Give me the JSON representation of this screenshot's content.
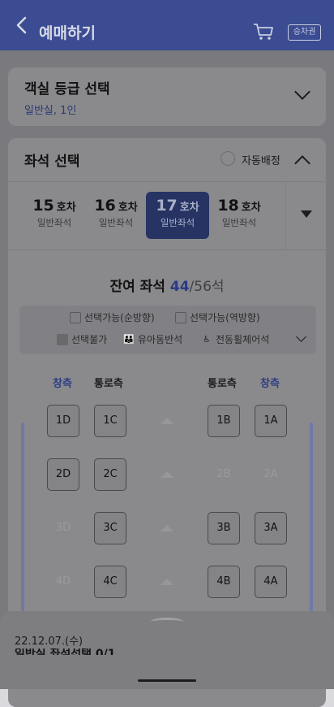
{
  "header": {
    "title": "예매하기",
    "ticket_label": "승차권"
  },
  "class_card": {
    "title": "객실 등급 선택",
    "subtitle": "일반실, 1인"
  },
  "seat_card": {
    "title": "좌석 선택",
    "auto_assign": "자동배정",
    "cars": [
      {
        "num": "15",
        "unit": "호차",
        "type": "일반좌석"
      },
      {
        "num": "16",
        "unit": "호차",
        "type": "일반좌석"
      },
      {
        "num": "17",
        "unit": "호차",
        "type": "일반좌석"
      },
      {
        "num": "18",
        "unit": "호차",
        "type": "일반좌석"
      }
    ],
    "remaining": {
      "label": "잔여 좌석",
      "count": "44",
      "total": "/56석"
    },
    "legend": {
      "forward": "선택가능(순방향)",
      "reverse": "선택가능(역방향)",
      "unavailable": "선택불가",
      "infant": "유아동반석",
      "wheelchair": "전동휠체어석"
    },
    "columns": {
      "window_left": "창측",
      "aisle_left": "통로측",
      "aisle_right": "통로측",
      "window_right": "창측"
    },
    "seats": [
      "1D",
      "1C",
      "1B",
      "1A",
      "2D",
      "2C",
      "2B",
      "2A",
      "3D",
      "3C",
      "3B",
      "3A",
      "4D",
      "4C",
      "4B",
      "4A"
    ]
  },
  "bottom_sheet": {
    "date": "22.12.07.(수)",
    "selection": "일반실 좌석선택 0/1"
  }
}
